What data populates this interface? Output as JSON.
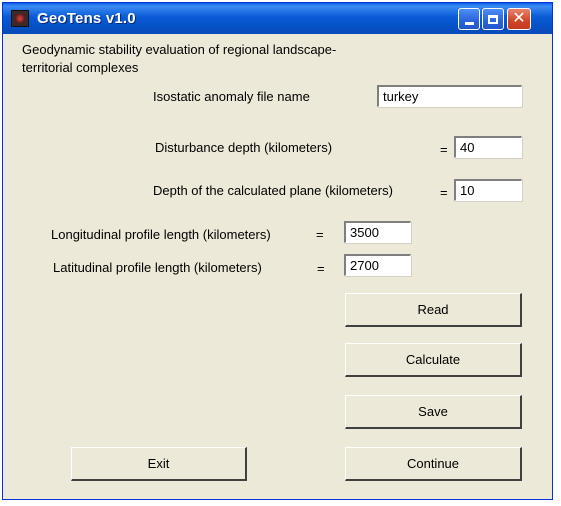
{
  "window": {
    "title": "GeoTens v1.0"
  },
  "description": "Geodynamic stability evaluation of regional landscape-territorial complexes",
  "fields": {
    "anomaly_file": {
      "label": "Isostatic anomaly file name",
      "value": "turkey"
    },
    "disturbance_depth": {
      "label": "Disturbance depth (kilometers)",
      "eq": "=",
      "value": "40"
    },
    "plane_depth": {
      "label": "Depth of the calculated plane (kilometers)",
      "eq": "=",
      "value": "10"
    },
    "longitudinal": {
      "label": "Longitudinal profile length (kilometers)",
      "eq": "=",
      "value": "3500"
    },
    "latitudinal": {
      "label": "Latitudinal profile length (kilometers)",
      "eq": "=",
      "value": "2700"
    }
  },
  "buttons": {
    "read": "Read",
    "calculate": "Calculate",
    "save": "Save",
    "exit": "Exit",
    "continue": "Continue"
  }
}
